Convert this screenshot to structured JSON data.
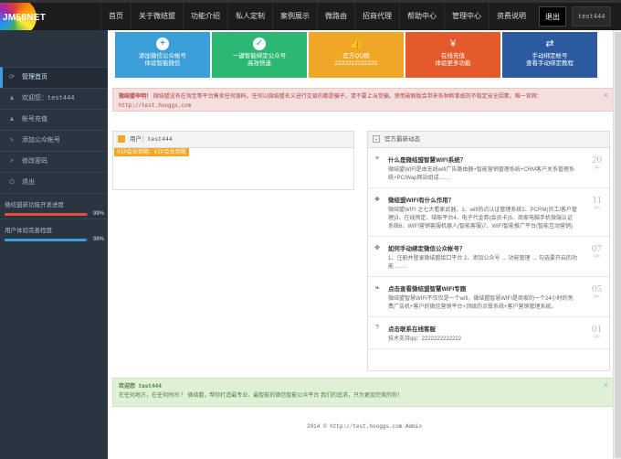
{
  "logo": {
    "text": "JM58NET"
  },
  "nav": {
    "items": [
      "首页",
      "关于微结盟",
      "功能介绍",
      "私人定制",
      "案例展示",
      "微路由",
      "招商代理",
      "帮助中心",
      "管理中心",
      "资费说明"
    ],
    "exit": "退出",
    "user": "test444"
  },
  "sidebar": {
    "items": [
      {
        "icon": "refresh-icon",
        "label": "管理首页",
        "active": true
      },
      {
        "icon": "user-icon",
        "label": "欢迎您：test444"
      },
      {
        "icon": "user-icon",
        "label": "帐号充值"
      },
      {
        "icon": "pencil-icon",
        "label": "添加公众帐号"
      },
      {
        "icon": "edit-icon",
        "label": "修改密码"
      },
      {
        "icon": "logout-icon",
        "label": "退出"
      }
    ],
    "progress": [
      {
        "label": "微结盟新功能开发进度",
        "pct": "99%",
        "value": 0.99,
        "color": "#e0503a"
      },
      {
        "label": "用户体验完善程度",
        "pct": "98%",
        "value": 0.98,
        "color": "#3aa0e0"
      }
    ]
  },
  "tiles": [
    {
      "icon": "plus-icon",
      "line1": "添加微信公众帐号",
      "line2": "体验智能微信",
      "color": "#3a9fd8",
      "glyph": "+"
    },
    {
      "icon": "check-icon",
      "line1": "一键智能绑定公众号",
      "line2": "高效快速",
      "color": "#2cb873",
      "glyph": "✓"
    },
    {
      "icon": "thumbs-up-icon",
      "line1": "官方QQ群",
      "line2": "2222222222222",
      "color": "#f0a726",
      "glyph": "👍"
    },
    {
      "icon": "money-icon",
      "line1": "在线充值",
      "line2": "体验更多功能",
      "color": "#e55a2c",
      "glyph": "¥"
    },
    {
      "icon": "shuffle-icon",
      "line1": "手动绑定帐号",
      "line2": "查看手动绑定教程",
      "color": "#2c5aa0",
      "glyph": "⇄"
    }
  ],
  "alert_red": {
    "title": "微结盟申明！",
    "text": "微结盟没有在淘宝等平台售卖任何源码，任何以微结盟名义进行交易的都是骗子，请不要上当受骗。使用破解版会带来各种断事故的不稳定安全因素。唯一官网：",
    "url": "http://test.hooggs.com"
  },
  "user_panel": {
    "title": "用户：test444",
    "badge": "VIP会员到期：VIP会员到期"
  },
  "news": {
    "title": "官方最新动态",
    "items": [
      {
        "icon": "list-icon",
        "glyph": "≡",
        "title": "什么是微结盟智慧WIFI系统？",
        "desc": "微结盟WIFI是由无线wifi广告路由器+智能营销管理系统+CRM客户关系管理系统+PC/Wap网站组成……",
        "day": "20",
        "mon": "jun"
      },
      {
        "icon": "gift-icon",
        "glyph": "❖",
        "title": "微结盟WIFI有什么作用？",
        "desc": "微结盟WIFI 之七大看家武器，1、wifi热点认证管理系统2、PCRM(员工/客户管理)3、在线预定、结账平台4、电子代金券(会员卡)5、商家电脑手机微端认证系统6、WIFI营销客服机器人(智能客服)7、WIFI智能推广平台(智能互动营销)",
        "day": "11",
        "mon": "jun"
      },
      {
        "icon": "move-icon",
        "glyph": "✥",
        "title": "如何手动绑定微信公众帐号？",
        "desc": "1、注册并登录微结盟接口平台 2、添加公众号 → 功能管理 → 勾选要开启的功能 ……",
        "day": "07",
        "mon": "jun"
      },
      {
        "icon": "leaf-icon",
        "glyph": "❧",
        "title": "点击查看微结盟智慧WIFI专题",
        "desc": "微结盟智慧WIFI不仅仅是一个wifi，微结盟智慧WIFI是商家的一个24小时的免费广告机+客户的微信营销平台+顶级的点餐系统+客户营销管理系统。",
        "day": "05",
        "mon": "jun"
      },
      {
        "icon": "question-icon",
        "glyph": "?",
        "title": "点击联系在线客服",
        "desc": "技术支持qq：2222222222222",
        "day": "01",
        "mon": "jun"
      }
    ]
  },
  "alert_green": {
    "title": "欢迎您 test444",
    "text": "在任何地方，在任何时间 ！ 微结盟，帮你打造最专业、最智能的微信智能公众平台 我们的追求，只为更加完美的你！"
  },
  "footer": {
    "text": "2014 © http://test.hooggs.com Admin"
  }
}
